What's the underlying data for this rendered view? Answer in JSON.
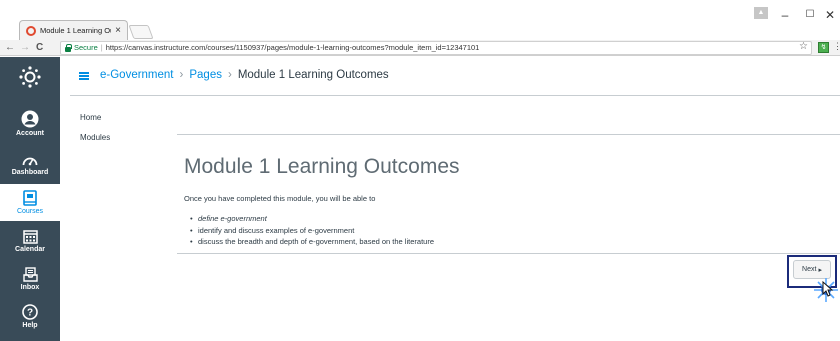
{
  "browser": {
    "tab_title": "Module 1 Learning Outc",
    "tab_close": "×",
    "window_user_glyph": "▲",
    "minimize": "–",
    "maximize": "☐",
    "close": "✕",
    "back": "←",
    "forward": "→",
    "reload": "C",
    "secure_label": "Secure",
    "url_separator": "|",
    "url": "https://canvas.instructure.com/courses/1150937/pages/module-1-learning-outcomes?module_item_id=12347101",
    "bookmark_star": "☆",
    "extension_glyph": "↯",
    "menu_dots": "⋮"
  },
  "global_nav": {
    "items": [
      {
        "label": "Account",
        "icon": "account-icon"
      },
      {
        "label": "Dashboard",
        "icon": "dashboard-icon"
      },
      {
        "label": "Courses",
        "icon": "courses-icon",
        "active": true
      },
      {
        "label": "Calendar",
        "icon": "calendar-icon"
      },
      {
        "label": "Inbox",
        "icon": "inbox-icon"
      },
      {
        "label": "Help",
        "icon": "help-icon"
      }
    ],
    "help_glyph": "?"
  },
  "breadcrumb": {
    "course": "e-Government",
    "section": "Pages",
    "current": "Module 1 Learning Outcomes",
    "separator": "›"
  },
  "course_nav": {
    "items": [
      "Home",
      "Modules"
    ]
  },
  "page": {
    "title": "Module 1 Learning Outcomes",
    "intro": "Once you have completed this module, you will be able to",
    "outcomes": [
      "define e-government",
      "identify and discuss examples of e-government",
      "discuss the breadth and depth of e-government, based on the literature"
    ]
  },
  "footer": {
    "next_label": "Next",
    "next_arrow": "▸"
  },
  "colors": {
    "nav_bg": "#394b58",
    "accent": "#008ee2",
    "highlight_border": "#1b2b7a"
  }
}
